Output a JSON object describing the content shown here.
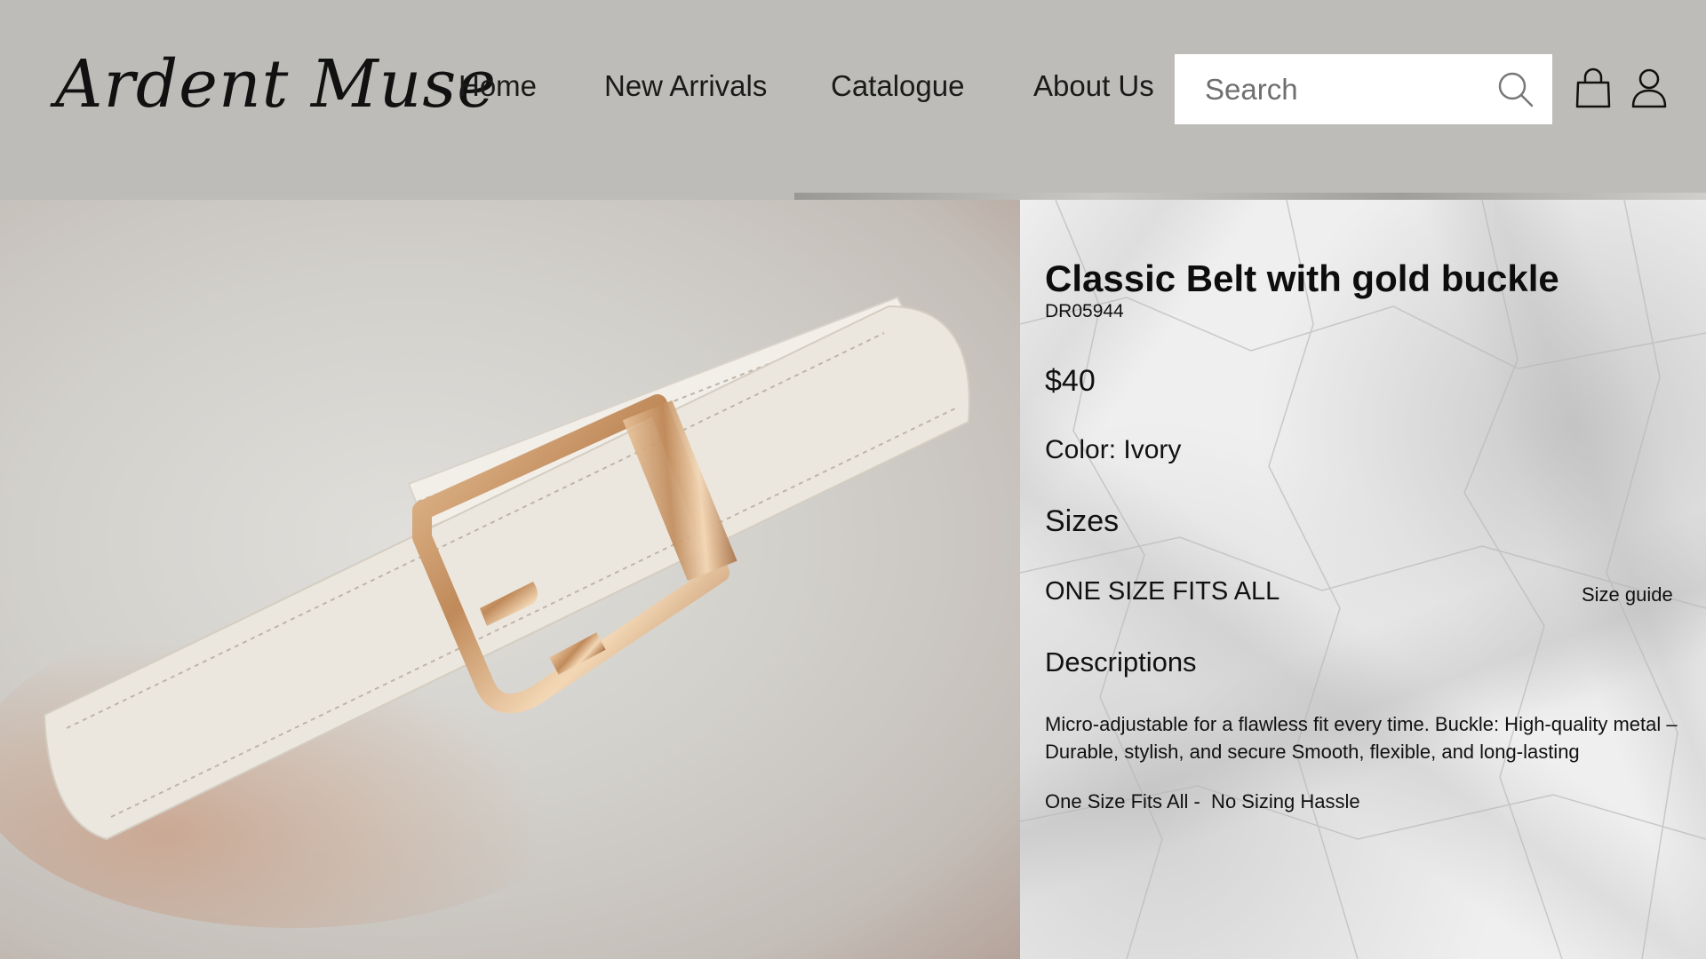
{
  "header": {
    "logo": "Ardent Muse",
    "nav": {
      "home": "Home",
      "new_arrivals": "New Arrivals",
      "catalogue": "Catalogue",
      "about_us": "About Us"
    },
    "search": {
      "placeholder": "Search",
      "value": ""
    },
    "icons": [
      "search-icon",
      "shopping-bag-icon",
      "user-icon"
    ]
  },
  "product": {
    "title": "Classic Belt with gold buckle",
    "sku": "DR05944",
    "price": "$40",
    "color": "Color: Ivory",
    "sizes_label": "Sizes",
    "size_value": "ONE SIZE FITS ALL",
    "size_guide": "Size guide",
    "descriptions_label": "Descriptions",
    "description": "Micro-adjustable for a flawless fit every time. Buckle: High-quality metal – Durable, stylish, and secure Smooth, flexible, and long-lasting",
    "note": "One Size Fits All -  No Sizing Hassle"
  },
  "colors": {
    "header_bg": "#bdbcb8",
    "search_bg": "#ffffff",
    "belt": "#ece7de",
    "buckle": "#c99a6c"
  }
}
